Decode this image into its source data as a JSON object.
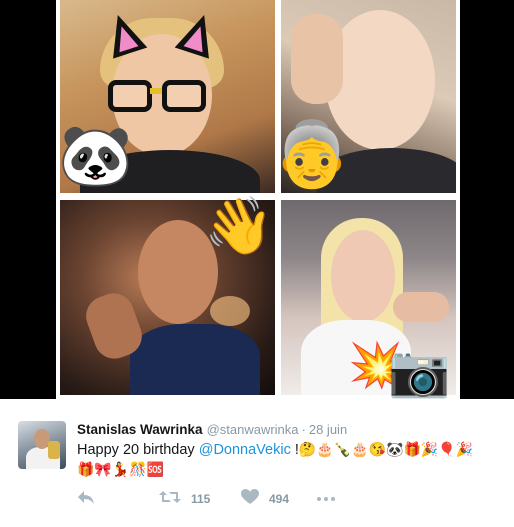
{
  "media": {
    "stickers": {
      "panda": "🐼",
      "granny": "👵",
      "wave": "👋",
      "boom": "💥",
      "camera": "📷"
    }
  },
  "tweet": {
    "author": {
      "fullname": "Stanislas Wawrinka",
      "username": "@stanwawrinka"
    },
    "separator": "·",
    "date": "28 juin",
    "text_part1": "Happy 20 birthday ",
    "mention": "@DonnaVekic",
    "text_part2": " !",
    "emojis_line1": "🤔🎂🍾🎂😘🐼🎁🎉🎈🎉",
    "emojis_line2": "🎁🎀💃🎊🆘",
    "actions": {
      "retweet_count": "115",
      "like_count": "494"
    }
  },
  "colors": {
    "mention": "#1b95e0",
    "secondary_text": "#8899a6",
    "action_icon": "#aab8c2",
    "media_background": "#000000"
  },
  "icons": [
    "reply-icon",
    "retweet-icon",
    "heart-icon",
    "more-icon"
  ]
}
